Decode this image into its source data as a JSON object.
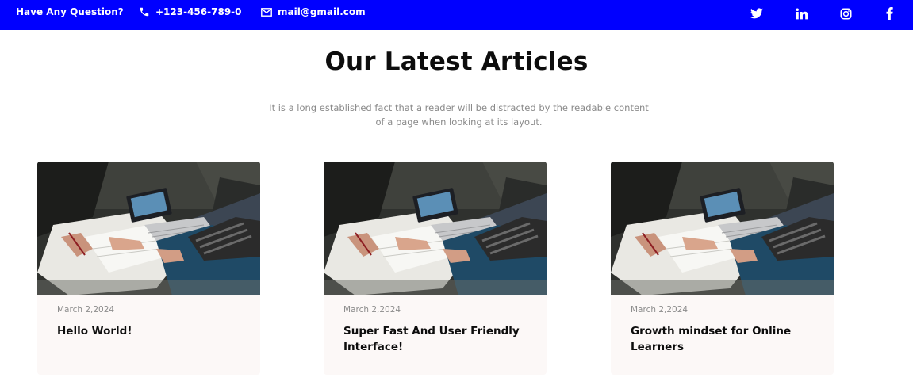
{
  "topbar": {
    "question": "Have Any Question?",
    "phone": "+123-456-789-0",
    "email": "mail@gmail.com",
    "social": [
      "twitter-icon",
      "linkedin-icon",
      "instagram-icon",
      "facebook-icon"
    ],
    "bg_color": "#0000ff"
  },
  "section": {
    "title": "Our Latest Articles",
    "subtitle": "It is a long established fact that a reader will be distracted by the readable content of a page when looking at its layout."
  },
  "articles": [
    {
      "date": "March 2,2024",
      "title": "Hello World!"
    },
    {
      "date": "March 2,2024",
      "title": "Super Fast And User Friendly Interface!"
    },
    {
      "date": "March 2,2024",
      "title": "Growth mindset for Online Learners"
    }
  ]
}
